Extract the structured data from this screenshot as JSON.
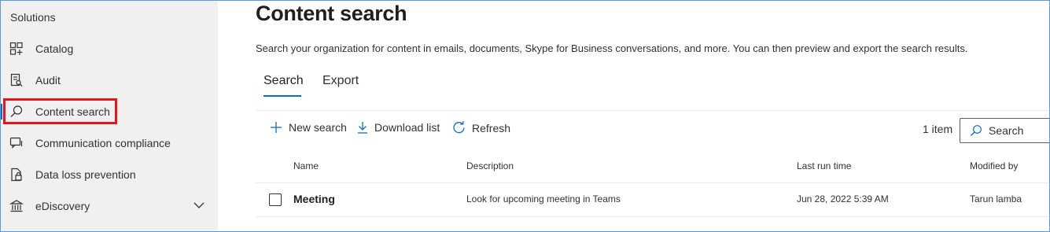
{
  "sidebar": {
    "heading": "Solutions",
    "items": [
      {
        "label": "Catalog",
        "icon": "catalog-icon"
      },
      {
        "label": "Audit",
        "icon": "audit-icon"
      },
      {
        "label": "Content search",
        "icon": "search-icon",
        "active": true
      },
      {
        "label": "Communication compliance",
        "icon": "chat-compliance-icon"
      },
      {
        "label": "Data loss prevention",
        "icon": "dlp-icon"
      },
      {
        "label": "eDiscovery",
        "icon": "ediscovery-icon",
        "expandable": true
      }
    ]
  },
  "main": {
    "title": "Content search",
    "description": "Search your organization for content in emails, documents, Skype for Business conversations, and more. You can then preview and export the search results.",
    "tabs": [
      {
        "label": "Search",
        "selected": true
      },
      {
        "label": "Export",
        "selected": false
      }
    ],
    "commands": {
      "new_search": "New search",
      "download_list": "Download list",
      "refresh": "Refresh"
    },
    "item_count": "1 item",
    "search": {
      "placeholder": "Search"
    },
    "columns": [
      "Name",
      "Description",
      "Last run time",
      "Modified by"
    ],
    "rows": [
      {
        "name": "Meeting",
        "description": "Look for upcoming meeting in Teams",
        "last_run": "Jun 28, 2022 5:39 AM",
        "modified_by": "Tarun lamba"
      }
    ]
  },
  "colors": {
    "accent": "#0f6cbd",
    "highlight": "#e8141a",
    "sidebar_bg": "#f0f0f0"
  }
}
